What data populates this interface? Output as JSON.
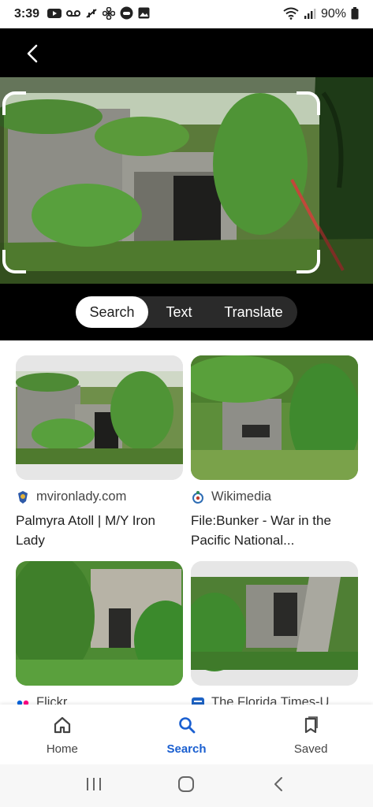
{
  "status_bar": {
    "time": "3:39",
    "battery": "90%"
  },
  "lens": {
    "modes": [
      "Search",
      "Text",
      "Translate"
    ],
    "active_mode": "Search"
  },
  "results": [
    {
      "source": "mvironlady.com",
      "title": "Palmyra Atoll | M/Y Iron Lady"
    },
    {
      "source": "Wikimedia",
      "title": "File:Bunker - War in the Pacific National..."
    },
    {
      "source": "Flickr",
      "title": ""
    },
    {
      "source": "The Florida Times-U...",
      "title": ""
    }
  ],
  "bottom_nav": {
    "home_label": "Home",
    "search_label": "Search",
    "saved_label": "Saved",
    "active": "Search"
  },
  "colors": {
    "accent": "#1a5fd0",
    "foliage": "#3f8a2e",
    "concrete": "#8d8d86"
  }
}
